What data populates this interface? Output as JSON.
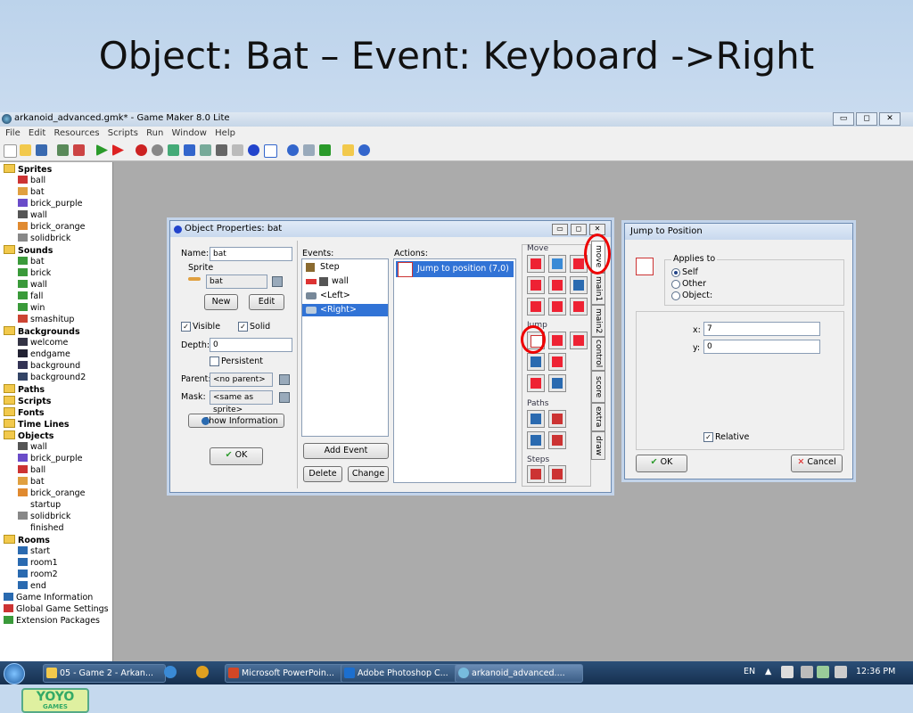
{
  "slide": {
    "title": "Object: Bat – Event: Keyboard ->Right"
  },
  "window": {
    "title": "arkanoid_advanced.gmk* - Game Maker 8.0 Lite",
    "controls": [
      "▭",
      "◻",
      "✕"
    ]
  },
  "menu": [
    "File",
    "Edit",
    "Resources",
    "Scripts",
    "Run",
    "Window",
    "Help"
  ],
  "tree": [
    {
      "label": "Sprites",
      "kind": "folder",
      "level": 0
    },
    {
      "label": "ball",
      "kind": "item",
      "level": 1,
      "color": "#c33"
    },
    {
      "label": "bat",
      "kind": "item",
      "level": 1,
      "color": "#e0a040"
    },
    {
      "label": "brick_purple",
      "kind": "item",
      "level": 1,
      "color": "#6a4cc9"
    },
    {
      "label": "wall",
      "kind": "item",
      "level": 1,
      "color": "#555"
    },
    {
      "label": "brick_orange",
      "kind": "item",
      "level": 1,
      "color": "#e08a30"
    },
    {
      "label": "solidbrick",
      "kind": "item",
      "level": 1,
      "color": "#888"
    },
    {
      "label": "Sounds",
      "kind": "folder",
      "level": 0
    },
    {
      "label": "bat",
      "kind": "item",
      "level": 1,
      "color": "#3a9a3a"
    },
    {
      "label": "brick",
      "kind": "item",
      "level": 1,
      "color": "#3a9a3a"
    },
    {
      "label": "wall",
      "kind": "item",
      "level": 1,
      "color": "#3a9a3a"
    },
    {
      "label": "fall",
      "kind": "item",
      "level": 1,
      "color": "#3a9a3a"
    },
    {
      "label": "win",
      "kind": "item",
      "level": 1,
      "color": "#3a9a3a"
    },
    {
      "label": "smashitup",
      "kind": "item",
      "level": 1,
      "color": "#c43"
    },
    {
      "label": "Backgrounds",
      "kind": "folder",
      "level": 0
    },
    {
      "label": "welcome",
      "kind": "item",
      "level": 1,
      "color": "#334"
    },
    {
      "label": "endgame",
      "kind": "item",
      "level": 1,
      "color": "#223"
    },
    {
      "label": "background",
      "kind": "item",
      "level": 1,
      "color": "#335"
    },
    {
      "label": "background2",
      "kind": "item",
      "level": 1,
      "color": "#346"
    },
    {
      "label": "Paths",
      "kind": "folder",
      "level": 0
    },
    {
      "label": "Scripts",
      "kind": "folder",
      "level": 0
    },
    {
      "label": "Fonts",
      "kind": "folder",
      "level": 0
    },
    {
      "label": "Time Lines",
      "kind": "folder",
      "level": 0
    },
    {
      "label": "Objects",
      "kind": "folder",
      "level": 0
    },
    {
      "label": "wall",
      "kind": "item",
      "level": 1,
      "color": "#555"
    },
    {
      "label": "brick_purple",
      "kind": "item",
      "level": 1,
      "color": "#6a4cc9"
    },
    {
      "label": "ball",
      "kind": "item",
      "level": 1,
      "color": "#c33"
    },
    {
      "label": "bat",
      "kind": "item",
      "level": 1,
      "color": "#e0a040"
    },
    {
      "label": "brick_orange",
      "kind": "item",
      "level": 1,
      "color": "#e08a30"
    },
    {
      "label": "startup",
      "kind": "item",
      "level": 1,
      "color": ""
    },
    {
      "label": "solidbrick",
      "kind": "item",
      "level": 1,
      "color": "#888"
    },
    {
      "label": "finished",
      "kind": "item",
      "level": 1,
      "color": ""
    },
    {
      "label": "Rooms",
      "kind": "folder",
      "level": 0
    },
    {
      "label": "start",
      "kind": "item",
      "level": 1,
      "color": "#2a6ab0"
    },
    {
      "label": "room1",
      "kind": "item",
      "level": 1,
      "color": "#2a6ab0"
    },
    {
      "label": "room2",
      "kind": "item",
      "level": 1,
      "color": "#2a6ab0"
    },
    {
      "label": "end",
      "kind": "item",
      "level": 1,
      "color": "#2a6ab0"
    },
    {
      "label": "Game Information",
      "kind": "item",
      "level": 0,
      "color": "#2a6ab0"
    },
    {
      "label": "Global Game Settings",
      "kind": "item",
      "level": 0,
      "color": "#c33"
    },
    {
      "label": "Extension Packages",
      "kind": "item",
      "level": 0,
      "color": "#3a9a3a"
    }
  ],
  "logo": {
    "text": "YOYO",
    "sub": "GAMES"
  },
  "object_props": {
    "title": "Object Properties: bat",
    "name_label": "Name:",
    "name_value": "bat",
    "sprite_group": "Sprite",
    "sprite_value": "bat",
    "new_btn": "New",
    "edit_btn": "Edit",
    "visible_label": "Visible",
    "solid_label": "Solid",
    "depth_label": "Depth:",
    "depth_value": "0",
    "persistent_label": "Persistent",
    "parent_label": "Parent:",
    "parent_value": "<no parent>",
    "mask_label": "Mask:",
    "mask_value": "<same as sprite>",
    "show_info_btn": "Show Information",
    "ok_btn": "OK",
    "events_label": "Events:",
    "events": [
      "Step",
      "wall",
      "<Left>",
      "<Right>"
    ],
    "selected_event": "<Right>",
    "add_event_btn": "Add Event",
    "delete_btn": "Delete",
    "change_btn": "Change",
    "actions_label": "Actions:",
    "actions": [
      "Jump to position (7,0)"
    ],
    "groups": {
      "move": "Move",
      "jump": "Jump",
      "paths": "Paths",
      "steps": "Steps"
    },
    "tabs": [
      "move",
      "main1",
      "main2",
      "control",
      "score",
      "extra",
      "draw"
    ]
  },
  "jump_dialog": {
    "title": "Jump to Position",
    "applies_to": "Applies to",
    "options": [
      "Self",
      "Other",
      "Object:"
    ],
    "selected": "Self",
    "x_label": "x:",
    "x_value": "7",
    "y_label": "y:",
    "y_value": "0",
    "relative_label": "Relative",
    "relative_checked": true,
    "ok_btn": "OK",
    "cancel_btn": "Cancel"
  },
  "taskbar": {
    "items": [
      "05 - Game 2 - Arkan...",
      "Microsoft PowerPoin...",
      "Adobe Photoshop C...",
      "arkanoid_advanced...."
    ],
    "lang": "EN",
    "time": "12:36 PM"
  }
}
